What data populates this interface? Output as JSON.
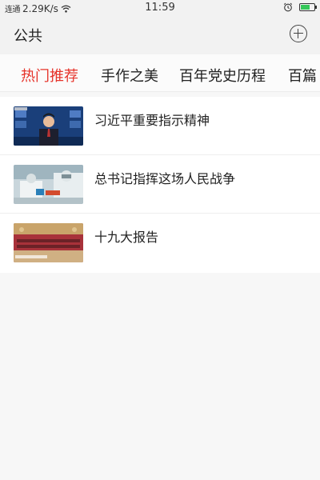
{
  "status_bar": {
    "carrier": "连通",
    "speed": "2.29K/s",
    "time": "11:59"
  },
  "header": {
    "title": "公共"
  },
  "tabs": [
    {
      "label": "热门推荐",
      "active": true
    },
    {
      "label": "手作之美",
      "active": false
    },
    {
      "label": "百年党史历程",
      "active": false
    },
    {
      "label": "百篇",
      "active": false
    }
  ],
  "items": [
    {
      "title": "习近平重要指示精神",
      "thumb": "news-anchor-image"
    },
    {
      "title": "总书记指挥这场人民战争",
      "thumb": "lab-workers-image"
    },
    {
      "title": "十九大报告",
      "thumb": "congress-hall-image"
    }
  ],
  "colors": {
    "active_tab": "#e6332a",
    "battery": "#35c759"
  }
}
